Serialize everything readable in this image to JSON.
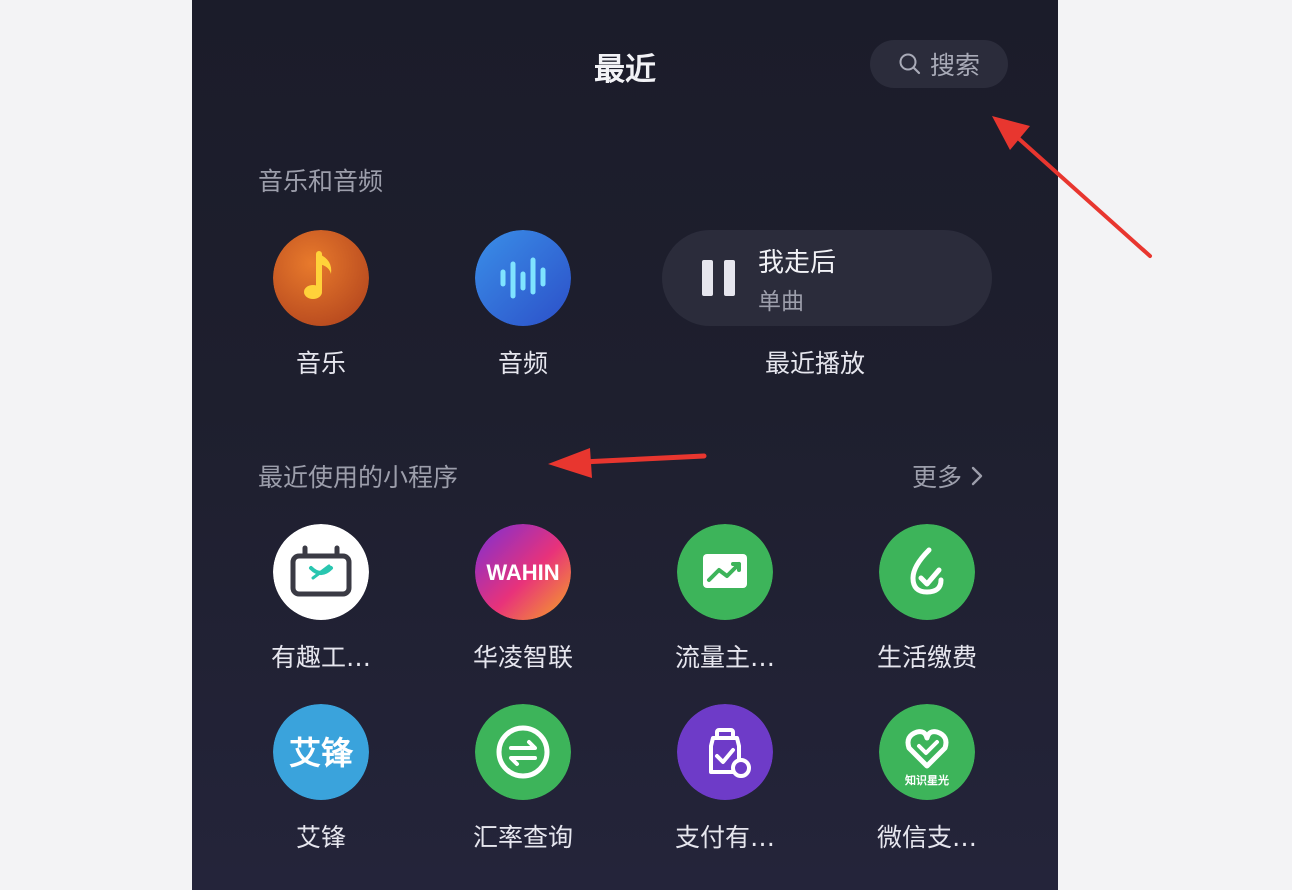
{
  "header": {
    "title": "最近",
    "search_label": "搜索"
  },
  "audio_section": {
    "title": "音乐和音频",
    "items": [
      {
        "label": "音乐",
        "icon": "music-note-icon"
      },
      {
        "label": "音频",
        "icon": "audio-wave-icon"
      }
    ],
    "recent_play": {
      "song": "我走后",
      "type": "单曲",
      "label": "最近播放"
    }
  },
  "miniprogram_section": {
    "title": "最近使用的小程序",
    "more_label": "更多",
    "items": [
      {
        "label": "有趣工…",
        "icon": "battery-icon"
      },
      {
        "label": "华凌智联",
        "icon": "wahin-logo",
        "logo_text": "WAHIN"
      },
      {
        "label": "流量主…",
        "icon": "trend-chart-icon"
      },
      {
        "label": "生活缴费",
        "icon": "water-drop-icon"
      },
      {
        "label": "艾锋",
        "icon": "aifeng-logo",
        "logo_text": "艾锋"
      },
      {
        "label": "汇率查询",
        "icon": "exchange-icon"
      },
      {
        "label": "支付有…",
        "icon": "payment-bottle-icon"
      },
      {
        "label": "微信支…",
        "icon": "heart-logo",
        "logo_text": "知识星光"
      }
    ]
  },
  "colors": {
    "background": "#1e1f2e",
    "pill": "#2b2c3b",
    "green": "#3db45a",
    "purple": "#6e3bc8",
    "annotation_arrow": "#e8362f"
  }
}
